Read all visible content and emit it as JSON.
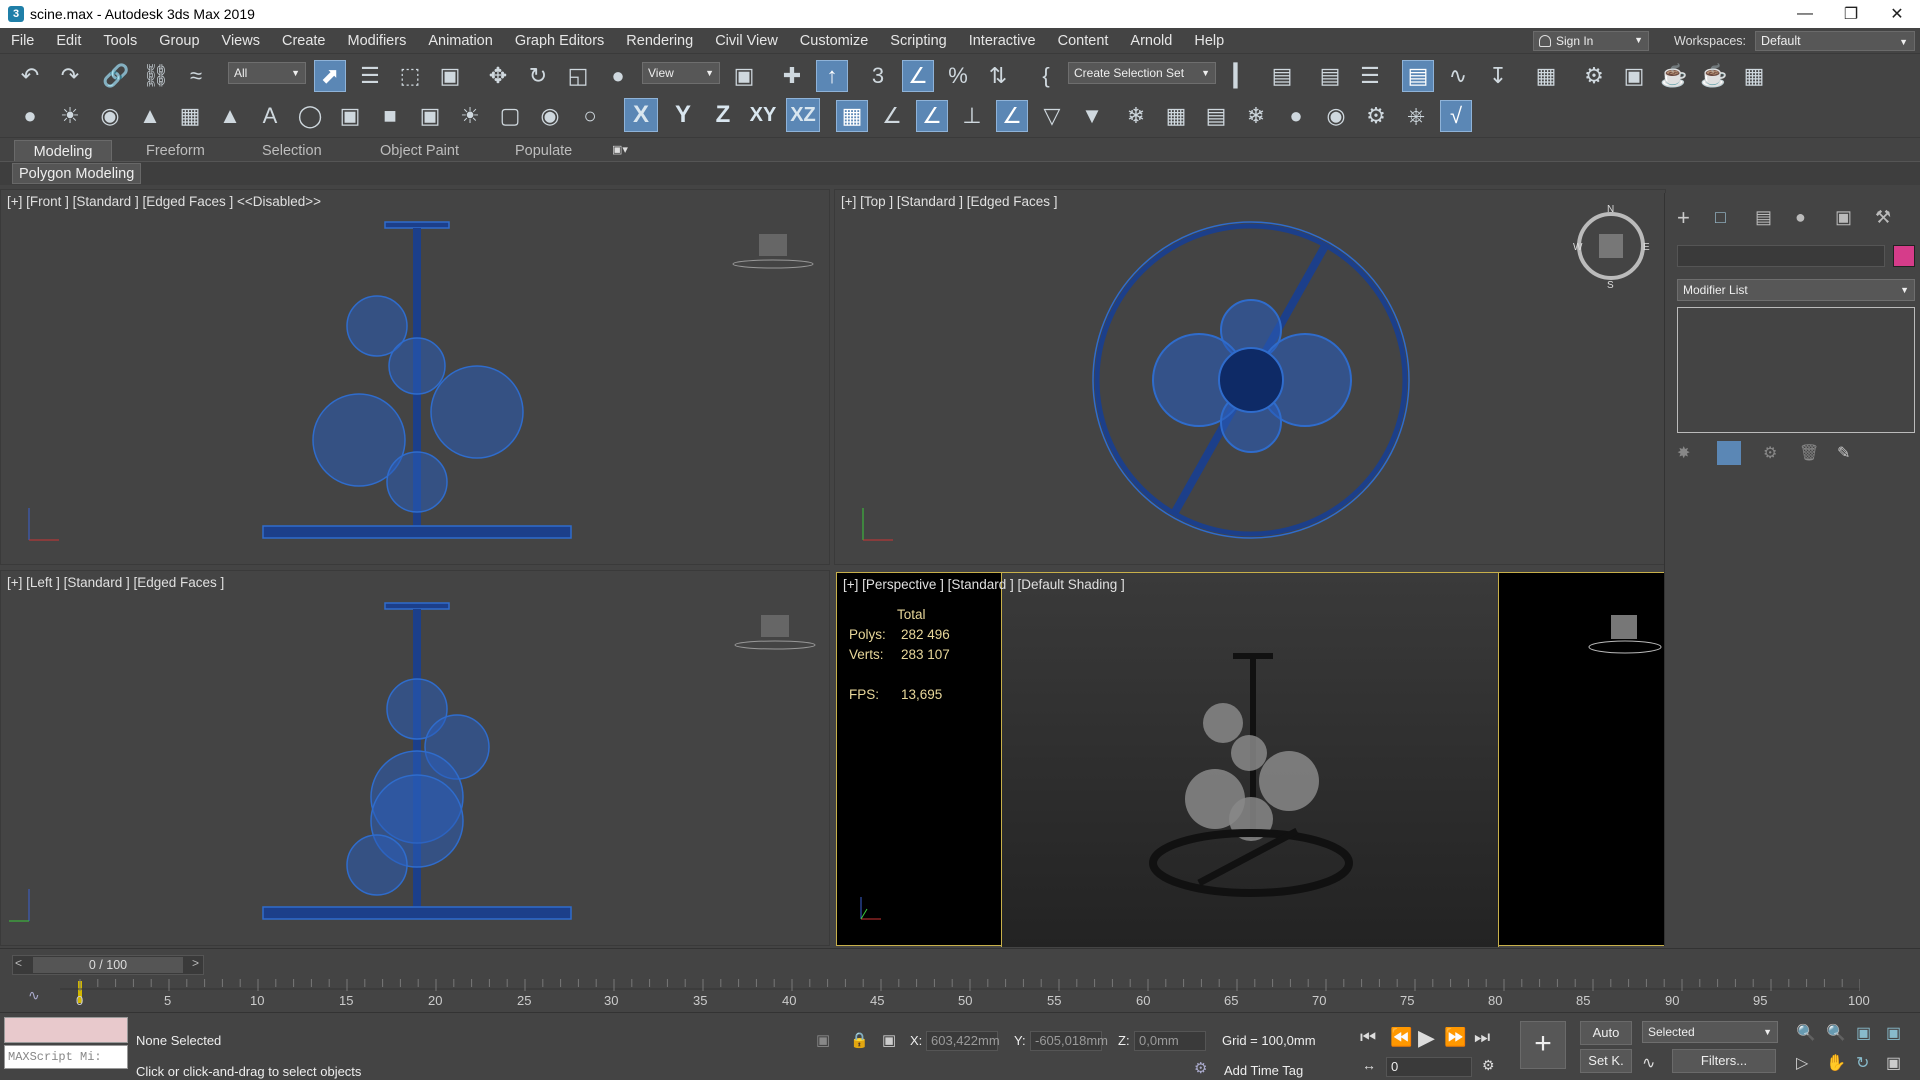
{
  "window": {
    "title": "scine.max - Autodesk 3ds Max 2019"
  },
  "menu": [
    "File",
    "Edit",
    "Tools",
    "Group",
    "Views",
    "Create",
    "Modifiers",
    "Animation",
    "Graph Editors",
    "Rendering",
    "Civil View",
    "Customize",
    "Scripting",
    "Interactive",
    "Content",
    "Arnold",
    "Help"
  ],
  "account": {
    "signin": "Sign In",
    "workspaces_label": "Workspaces:",
    "workspace": "Default"
  },
  "toolbar": {
    "filter": "All",
    "refcoord": "View",
    "selection_set": "Create Selection Set",
    "axis_x": "X",
    "axis_y": "Y",
    "axis_z": "Z",
    "axis_xy": "XY",
    "axis_xz": "XZ"
  },
  "ribbon": {
    "tabs": [
      "Modeling",
      "Freeform",
      "Selection",
      "Object Paint",
      "Populate"
    ],
    "active_tab": "Modeling",
    "panel": "Polygon Modeling"
  },
  "viewports": {
    "front": "[+] [Front ] [Standard ] [Edged Faces ]  <<Disabled>>",
    "top": "[+] [Top ] [Standard ] [Edged Faces ]",
    "left": "[+] [Left ] [Standard ] [Edged Faces ]",
    "perspective": "[+] [Perspective ] [Standard ] [Default Shading ]",
    "stats": {
      "total_label": "Total",
      "polys_label": "Polys:",
      "polys": "282 496",
      "verts_label": "Verts:",
      "verts": "283 107",
      "fps_label": "FPS:",
      "fps": "13,695"
    }
  },
  "command_panel": {
    "modifier_list": "Modifier List"
  },
  "timeline": {
    "frame": "0 / 100",
    "ticks": [
      "0",
      "5",
      "10",
      "15",
      "20",
      "25",
      "30",
      "35",
      "40",
      "45",
      "50",
      "55",
      "60",
      "65",
      "70",
      "75",
      "80",
      "85",
      "90",
      "95",
      "100"
    ]
  },
  "status": {
    "selection": "None Selected",
    "prompt": "Click or click-and-drag to select objects",
    "maxscript": "MAXScript Mi:",
    "x_label": "X:",
    "x": "603,422mm",
    "y_label": "Y:",
    "y": "-605,018mm",
    "z_label": "Z:",
    "z": "0,0mm",
    "grid": "Grid = 100,0mm",
    "add_time_tag": "Add Time Tag",
    "auto": "Auto",
    "setkey": "Set K.",
    "selected": "Selected",
    "filters": "Filters...",
    "frame_field": "0"
  },
  "colors": {
    "accent": "#5b87b5",
    "viewport_bg": "#444444",
    "wire_blue": "#2f6ccc",
    "perspective_border": "#c8b04a",
    "swatch": "#d63c8a"
  }
}
